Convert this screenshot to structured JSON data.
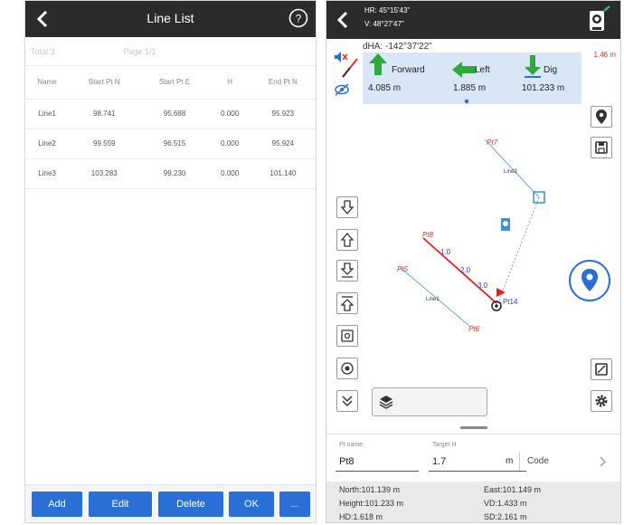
{
  "left": {
    "title": "Line List",
    "total": "Total:3",
    "page": "Page:1/1",
    "columns": [
      "Name",
      "Start Pt N",
      "Start Pt E",
      "H",
      "End Pt N"
    ],
    "rows": [
      [
        "Line1",
        "98.741",
        "95.688",
        "0.000",
        "95.923"
      ],
      [
        "Line2",
        "99.559",
        "96.515",
        "0.000",
        "95.924"
      ],
      [
        "Line3",
        "103.283",
        "99.230",
        "0.000",
        "101.140"
      ]
    ],
    "buttons": {
      "add": "Add",
      "edit": "Edit",
      "delete": "Delete",
      "ok": "OK",
      "more": "..."
    }
  },
  "right": {
    "hr": "HR: 45°15'43\"",
    "v": "V: 48°27'47\"",
    "dha": "dHA: -142°37'22\"",
    "dist_right": "1.46 m",
    "stake": {
      "forward_label": "Forward",
      "forward_val": "4.085 m",
      "left_label": "Left",
      "left_val": "1.885 m",
      "dig_label": "Dig",
      "dig_val": "101.233 m"
    },
    "map_labels": {
      "pt7": "Pt7",
      "line3": "Line3",
      "pt8": "Pt8",
      "pt5": "Pt5",
      "line1": "Line1",
      "pt6": "Pt6",
      "l2": "2.0",
      "l1": "1.0",
      "l3": "3.0",
      "pt14": "Pt14"
    },
    "entry": {
      "pt_name_label": "Pt name",
      "pt_name_val": "Pt8",
      "target_h_label": "Target H",
      "target_h_val": "1.7",
      "unit": "m",
      "code_label": "Code"
    },
    "info": {
      "north": "North:101.139 m",
      "east": "East:101.149 m",
      "height": "Height:101.233 m",
      "vd": "VD:1.433 m",
      "hd": "HD:1.618 m",
      "sd": "SD:2.161 m"
    }
  }
}
